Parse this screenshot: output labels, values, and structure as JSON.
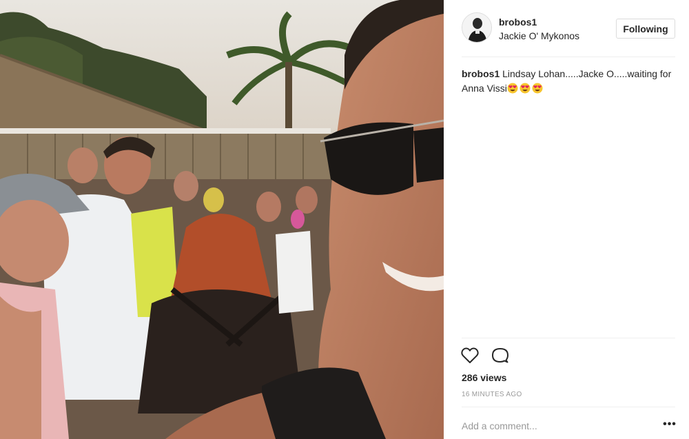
{
  "post": {
    "username": "brobos1",
    "location": "Jackie O' Mykonos",
    "follow_label": "Following",
    "caption_user": "brobos1",
    "caption_text": " Lindsay Lohan.....Jacke O.....waiting for Anna Vissi",
    "caption_emojis": [
      "heart-eyes",
      "heart-eyes",
      "heart-eyes"
    ],
    "views": "286 views",
    "timestamp": "16 MINUTES AGO",
    "comment_placeholder": "Add a comment...",
    "more_label": "•••"
  },
  "icons": {
    "like": "heart-outline-icon",
    "comment": "speech-bubble-icon",
    "more": "ellipsis-icon"
  },
  "colors": {
    "text": "#262626",
    "muted": "#999999",
    "border": "#dbdbdb",
    "divider": "#efefef"
  }
}
